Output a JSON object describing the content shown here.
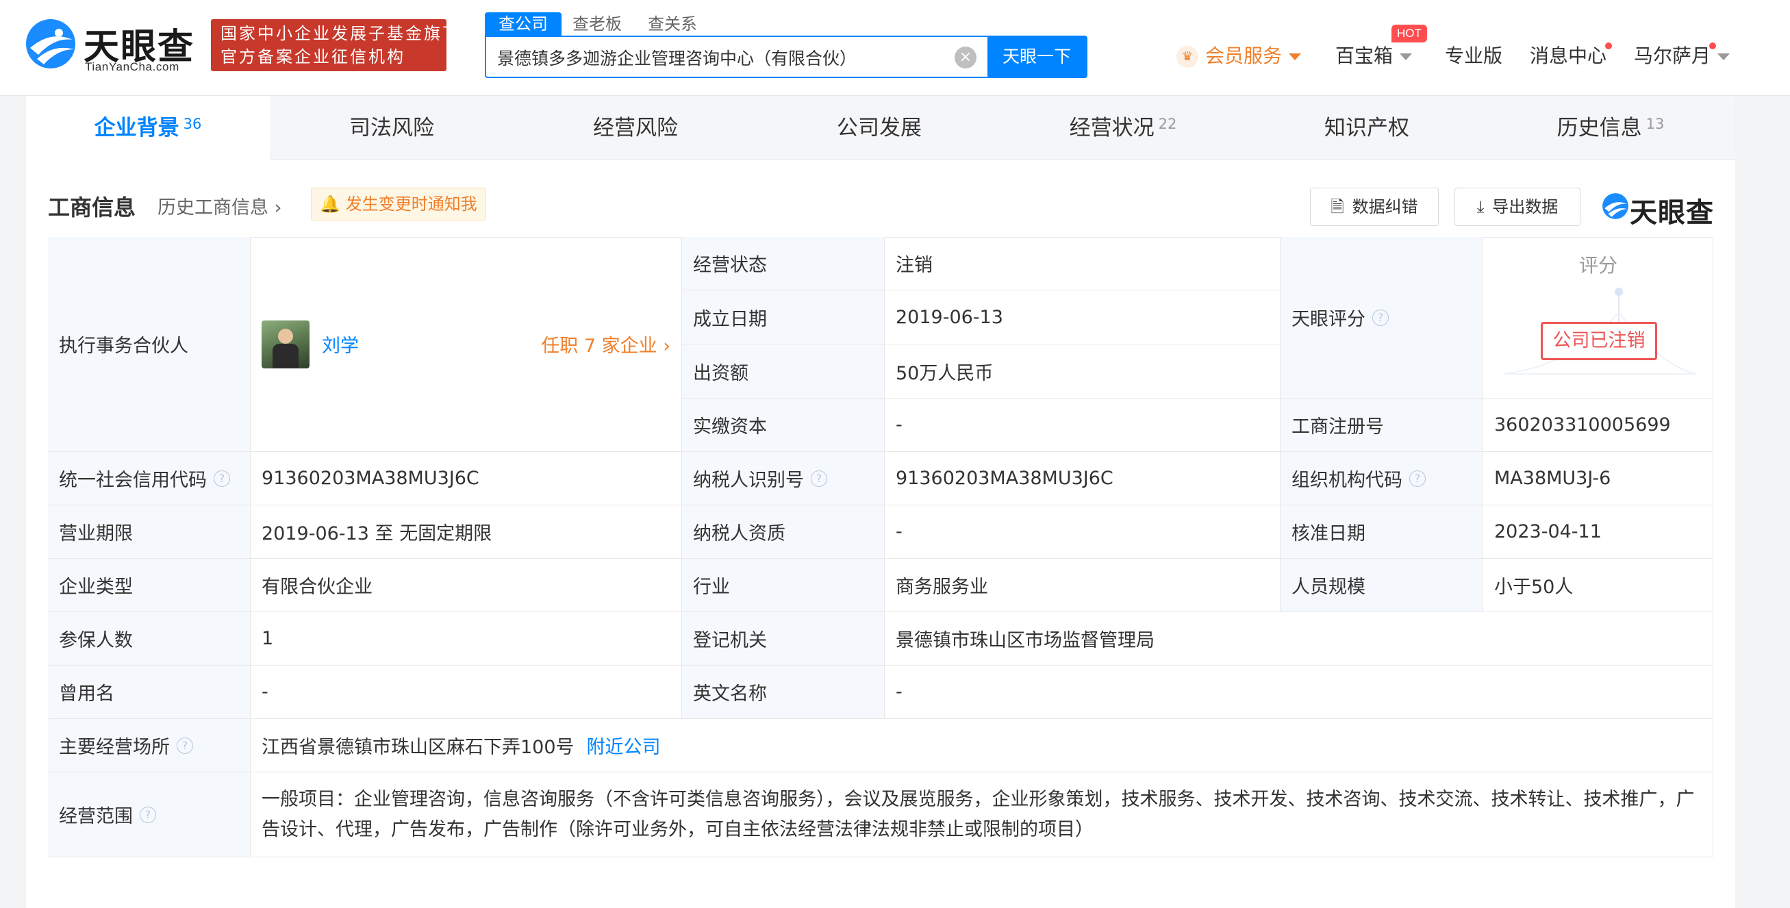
{
  "header": {
    "logo_text": "天眼查",
    "logo_sub": "TianYanCha.com",
    "gov_badge_line1": "国家中小企业发展子基金旗下",
    "gov_badge_line2": "官方备案企业征信机构",
    "search_tabs": [
      "查公司",
      "查老板",
      "查关系"
    ],
    "search_value": "景德镇多多迦游企业管理咨询中心（有限合伙）",
    "search_button": "天眼一下",
    "nav": {
      "vip": "会员服务",
      "baibaoxiang": "百宝箱",
      "hot": "HOT",
      "pro": "专业版",
      "messages": "消息中心",
      "user": "马尔萨月"
    }
  },
  "tabs": [
    {
      "label": "企业背景",
      "count": "36"
    },
    {
      "label": "司法风险",
      "count": ""
    },
    {
      "label": "经营风险",
      "count": ""
    },
    {
      "label": "公司发展",
      "count": ""
    },
    {
      "label": "经营状况",
      "count": "22"
    },
    {
      "label": "知识产权",
      "count": ""
    },
    {
      "label": "历史信息",
      "count": "13"
    }
  ],
  "section": {
    "title": "工商信息",
    "history_link": "历史工商信息",
    "notify_button": "发生变更时通知我",
    "correct_button": "数据纠错",
    "export_button": "导出数据",
    "watermark": "天眼查"
  },
  "info": {
    "partner_label": "执行事务合伙人",
    "partner_name": "刘学",
    "partner_positions": "任职 7 家企业",
    "status_label": "经营状态",
    "status_value": "注销",
    "established_label": "成立日期",
    "established_value": "2019-06-13",
    "capital_label": "出资额",
    "capital_value": "50万人民币",
    "paidin_label": "实缴资本",
    "paidin_value": "-",
    "score_label": "天眼评分",
    "score_title": "评分",
    "score_stamp": "公司已注销",
    "regno_label": "工商注册号",
    "regno_value": "360203310005699",
    "credit_label": "统一社会信用代码",
    "credit_value": "91360203MA38MU3J6C",
    "taxid_label": "纳税人识别号",
    "taxid_value": "91360203MA38MU3J6C",
    "orgcode_label": "组织机构代码",
    "orgcode_value": "MA38MU3J-6",
    "term_label": "营业期限",
    "term_value": "2019-06-13 至 无固定期限",
    "taxqual_label": "纳税人资质",
    "taxqual_value": "-",
    "approve_label": "核准日期",
    "approve_value": "2023-04-11",
    "type_label": "企业类型",
    "type_value": "有限合伙企业",
    "industry_label": "行业",
    "industry_value": "商务服务业",
    "staff_label": "人员规模",
    "staff_value": "小于50人",
    "insured_label": "参保人数",
    "insured_value": "1",
    "authority_label": "登记机关",
    "authority_value": "景德镇市珠山区市场监督管理局",
    "formername_label": "曾用名",
    "formername_value": "-",
    "english_label": "英文名称",
    "english_value": "-",
    "address_label": "主要经营场所",
    "address_value": "江西省景德镇市珠山区麻石下弄100号",
    "nearby_link": "附近公司",
    "scope_label": "经营范围",
    "scope_value": "一般项目：企业管理咨询，信息咨询服务（不含许可类信息咨询服务），会议及展览服务，企业形象策划，技术服务、技术开发、技术咨询、技术交流、技术转让、技术推广，广告设计、代理，广告发布，广告制作（除许可业务外，可自主依法经营法律法规非禁止或限制的项目）"
  },
  "colors": {
    "accent": "#0084ff",
    "orange": "#ef7f2a",
    "stamp_red": "#e55"
  }
}
